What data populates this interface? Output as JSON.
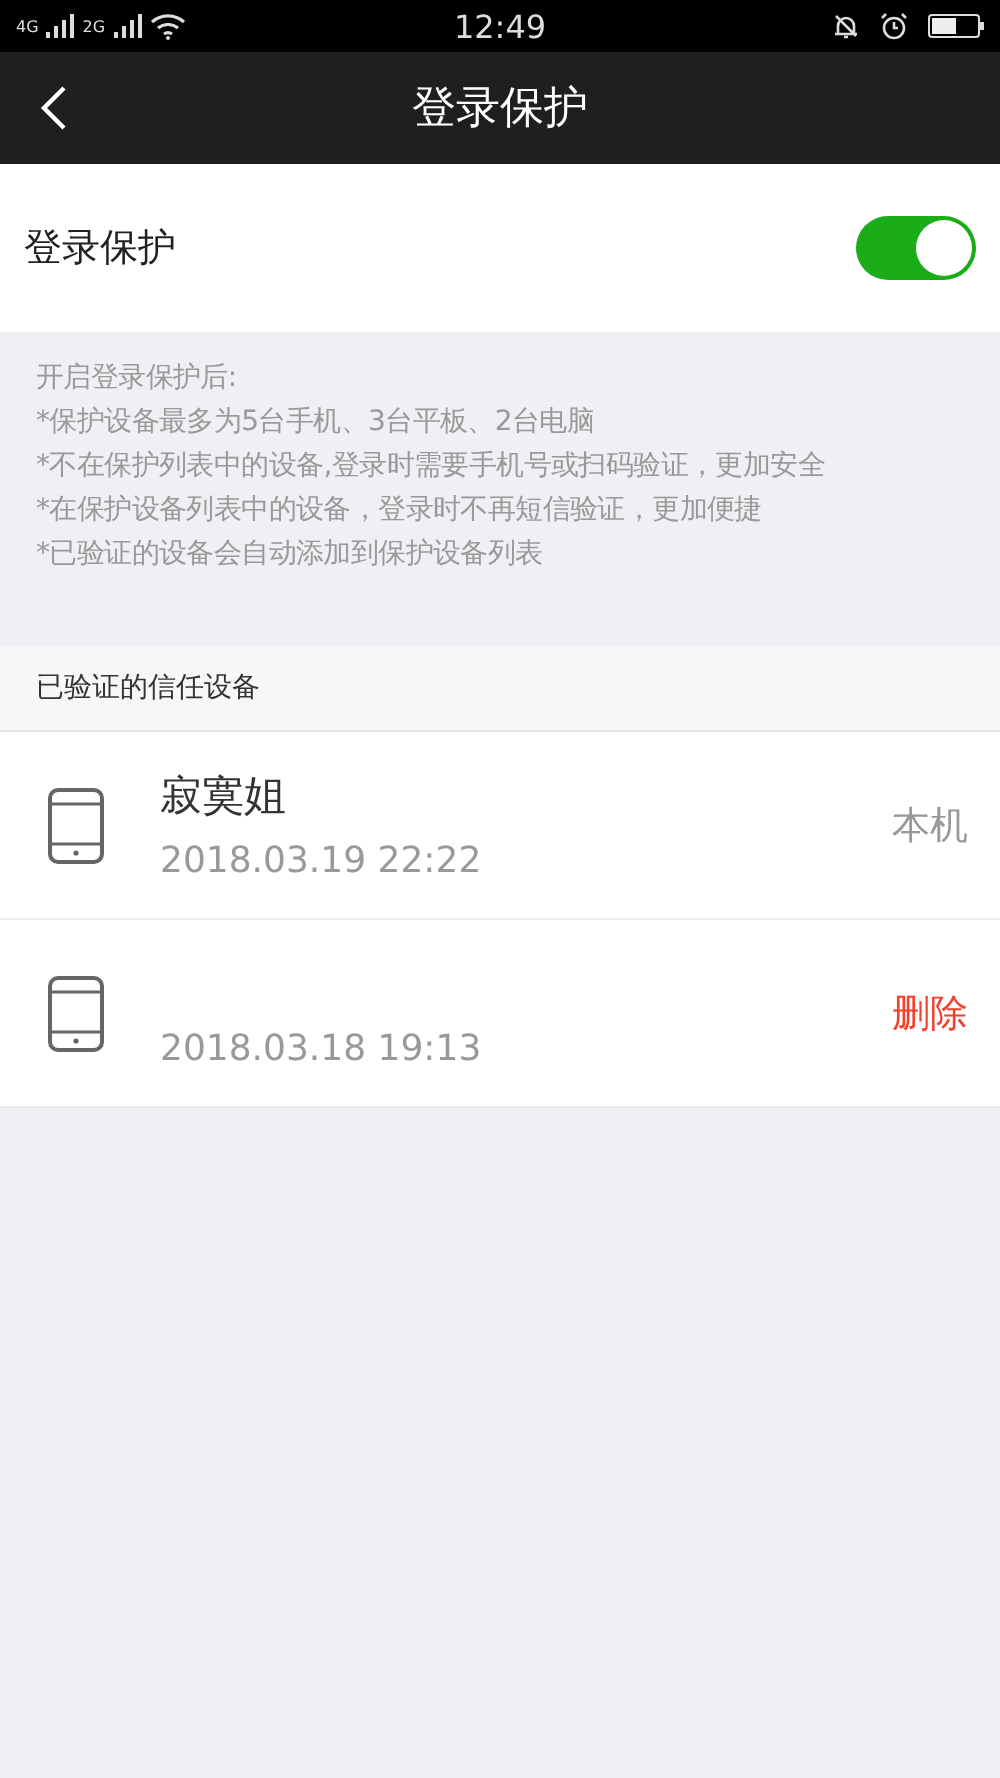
{
  "status_bar": {
    "network_1": "4G",
    "network_2": "2G",
    "time": "12:49"
  },
  "nav": {
    "title": "登录保护"
  },
  "setting": {
    "label": "登录保护",
    "on": true
  },
  "notes": [
    "开启登录保护后:",
    "*保护设备最多为5台手机、3台平板、2台电脑",
    "*不在保护列表中的设备,登录时需要手机号或扫码验证，更加安全",
    "*在保护设备列表中的设备，登录时不再短信验证，更加便捷",
    "*已验证的设备会自动添加到保护设备列表"
  ],
  "devices_header": "已验证的信任设备",
  "devices": [
    {
      "name": "寂寞姐",
      "time": "2018.03.19 22:22",
      "action": "本机",
      "kind": "current"
    },
    {
      "time": "2018.03.18 19:13",
      "action": "删除",
      "kind": "delete"
    }
  ]
}
